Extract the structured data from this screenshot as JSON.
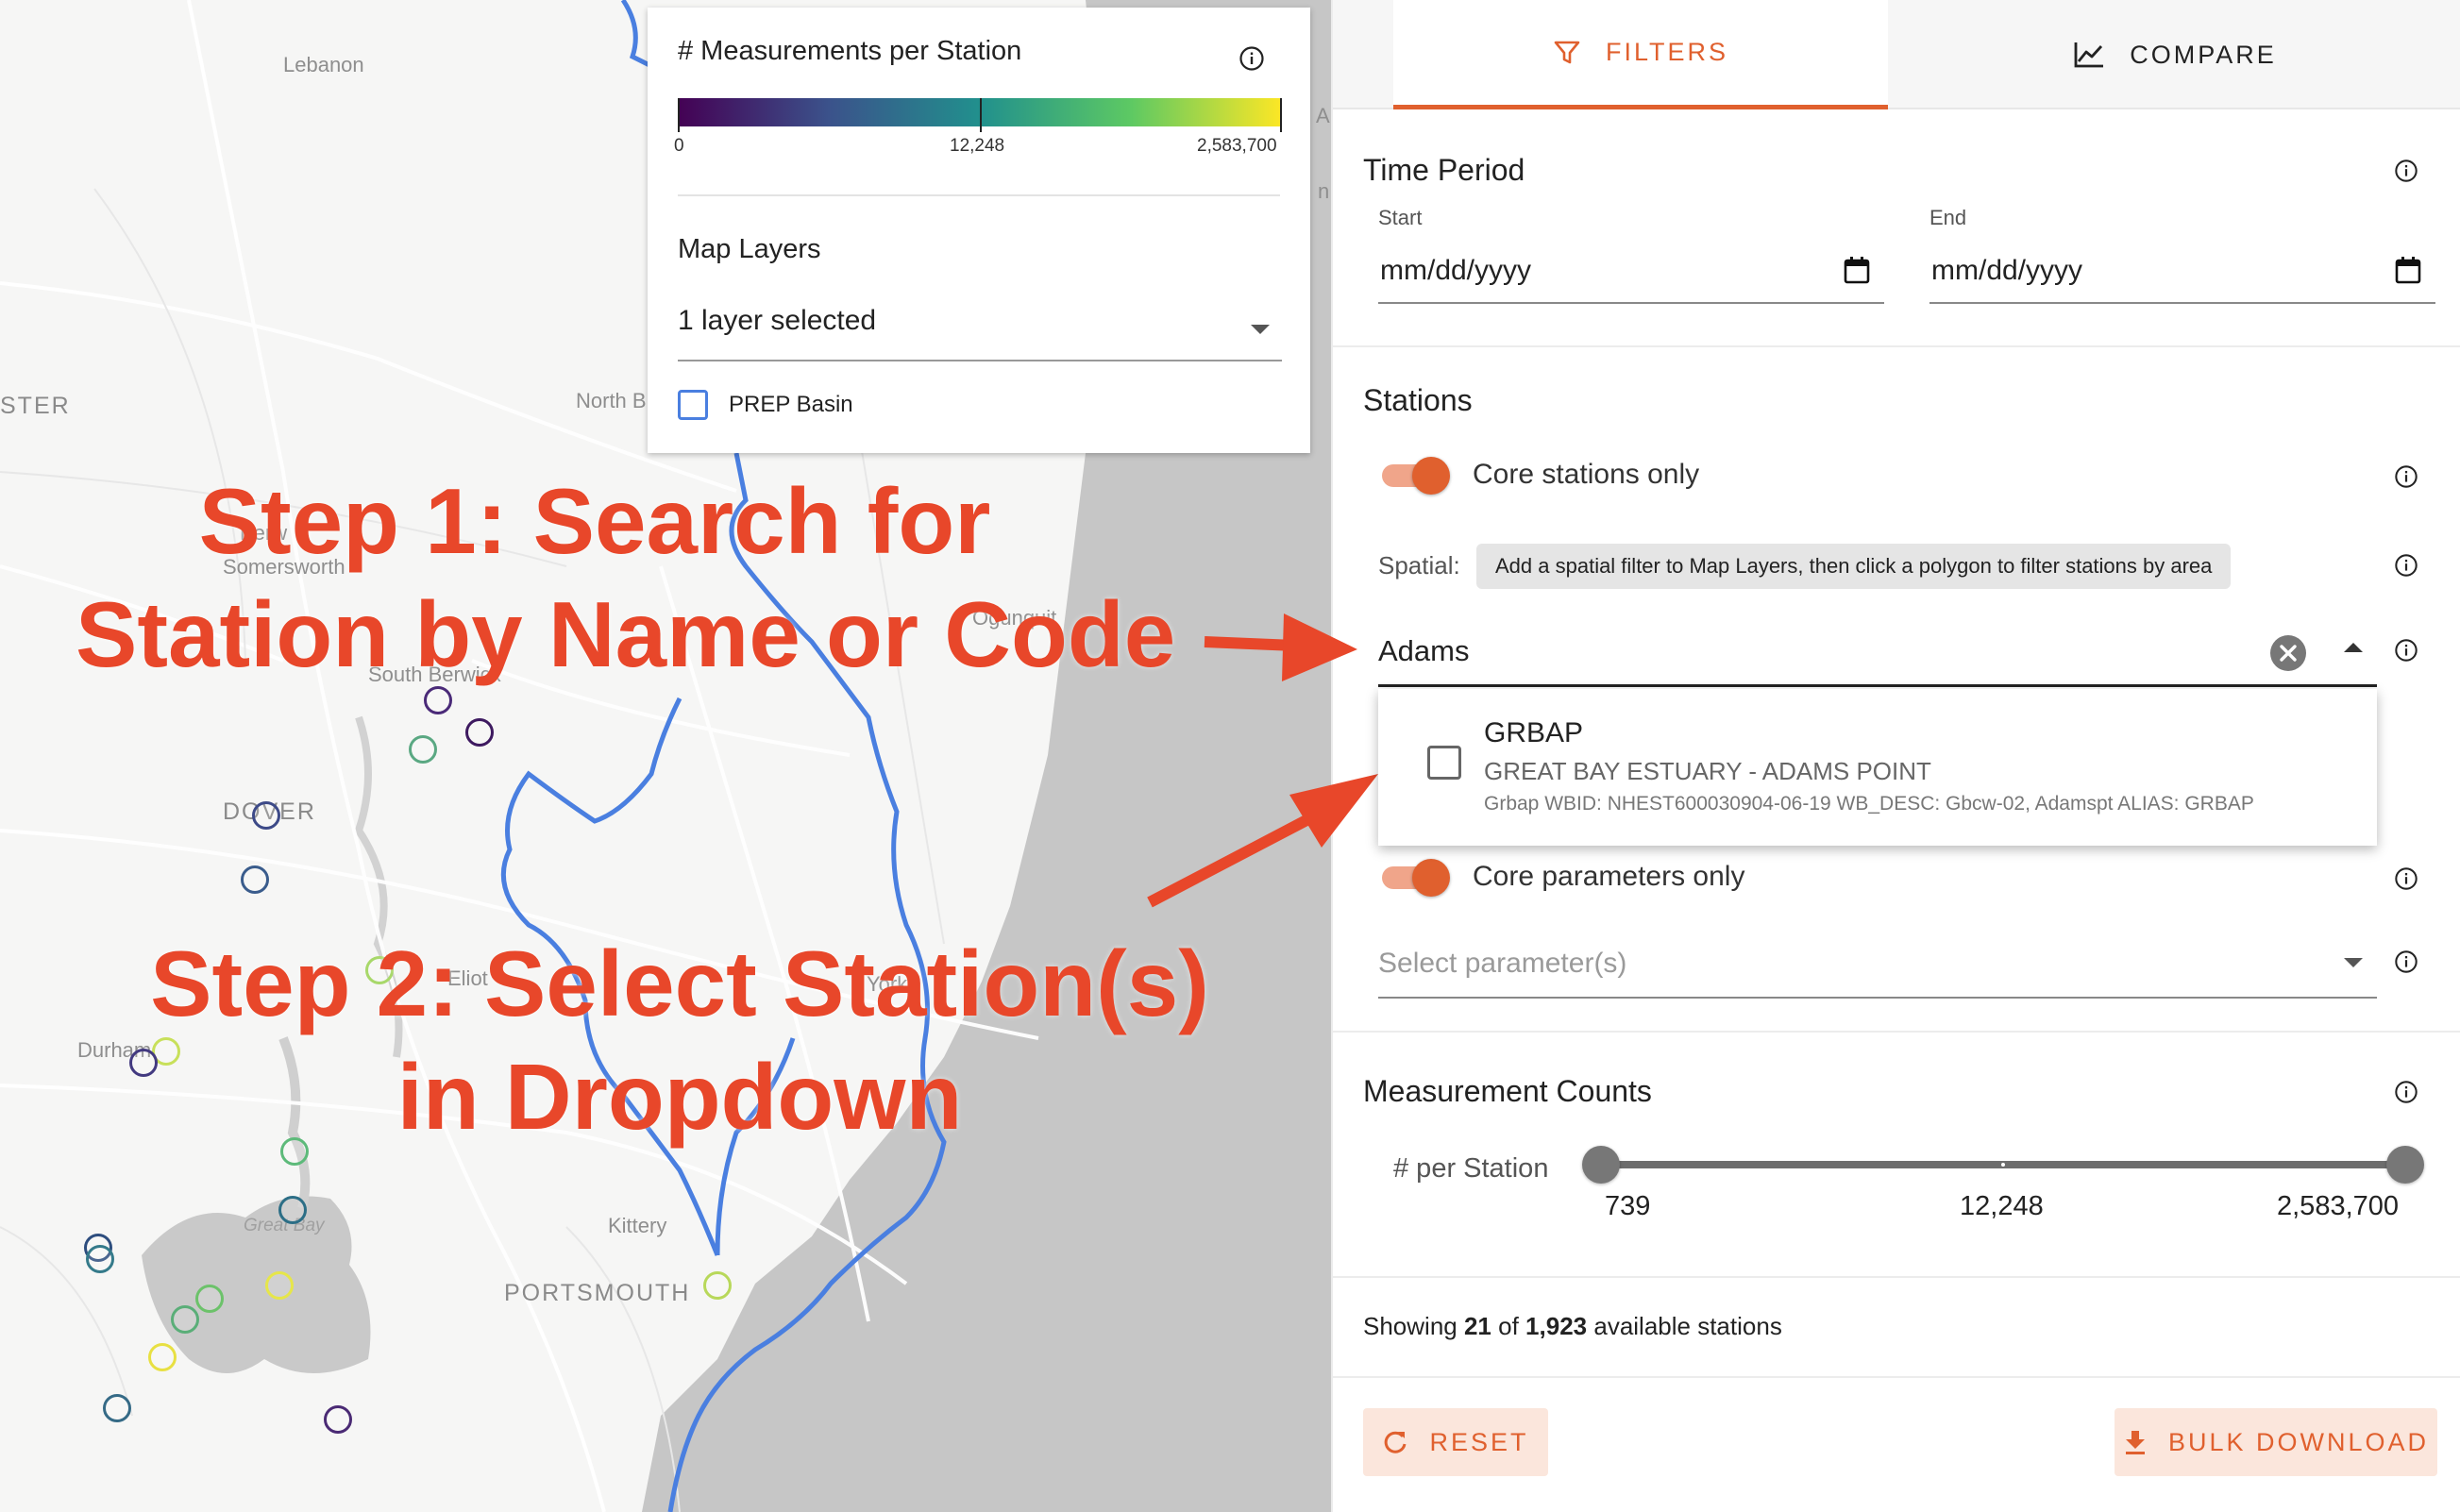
{
  "map": {
    "places": {
      "lebanon": "Lebanon",
      "ster": "STER",
      "north_berwick": "North B",
      "somersworth": "Somersworth",
      "berwick": "Berw",
      "south_berwick": "South Berwick",
      "dover": "DOVER",
      "eliot": "Eliot",
      "york": "York",
      "durham": "Durham",
      "great_bay": "Great Bay",
      "kittery": "Kittery",
      "portsmouth": "PORTSMOUTH",
      "ogunquit": "Ogunquit",
      "wells": "A",
      "wells2": "n"
    },
    "colors": {
      "land": "#f6f6f5",
      "water": "#c4c4c4",
      "basin_boundary": "#4a7fe0",
      "roads": "#ffffff"
    }
  },
  "legend": {
    "title": "# Measurements per Station",
    "colorbar": {
      "min_label": "0",
      "mid_label": "12,248",
      "max_label": "2,583,700",
      "colors": [
        "#440154",
        "#3b528b",
        "#21908d",
        "#5dc963",
        "#fde725"
      ]
    },
    "layers_title": "Map Layers",
    "layers_value": "1 layer selected",
    "layer_option": "PREP Basin"
  },
  "annotations": {
    "step1_line1": "Step 1: Search for",
    "step1_line2": "Station by Name or Code",
    "step2_line1": "Step 2: Select Station(s)",
    "step2_line2": "in Dropdown",
    "color": "#e8472a"
  },
  "tabs": {
    "filters": "FILTERS",
    "compare": "COMPARE",
    "active": "filters",
    "accent": "#e0602e"
  },
  "time_period": {
    "title": "Time Period",
    "start_label": "Start",
    "start_value": "mm/dd/yyyy",
    "end_label": "End",
    "end_value": "mm/dd/yyyy"
  },
  "stations": {
    "title": "Stations",
    "core_only_label": "Core stations only",
    "core_only_checked": true,
    "spatial_label": "Spatial:",
    "spatial_chip": "Add a spatial filter to Map Layers, then click a polygon to filter stations by area",
    "search_value": "Adams",
    "dropdown": [
      {
        "code": "GRBAP",
        "name": "GREAT BAY ESTUARY - ADAMS POINT",
        "description": "Grbap WBID: NHEST600030904-06-19 WB_DESC: Gbcw-02, Adamspt ALIAS: GRBAP",
        "checked": false
      }
    ]
  },
  "parameters": {
    "core_only_label": "Core parameters only",
    "core_only_checked": true,
    "placeholder": "Select parameter(s)"
  },
  "measurement_counts": {
    "title": "Measurement Counts",
    "per_station_label": "# per Station",
    "min": "739",
    "mid": "12,248",
    "max": "2,583,700"
  },
  "summary": {
    "prefix": "Showing",
    "shown": "21",
    "of": "of",
    "total": "1,923",
    "suffix": "available stations"
  },
  "buttons": {
    "reset": "RESET",
    "bulk_download": "BULK DOWNLOAD"
  },
  "icons": {
    "filter_tab": "filter-icon",
    "compare_tab": "line-chart-icon",
    "info": "info-icon",
    "calendar": "calendar-icon",
    "clear": "clear-circle-icon",
    "caret_up": "caret-up-icon",
    "caret_down": "caret-down-icon",
    "reset": "refresh-icon",
    "download": "download-icon"
  }
}
